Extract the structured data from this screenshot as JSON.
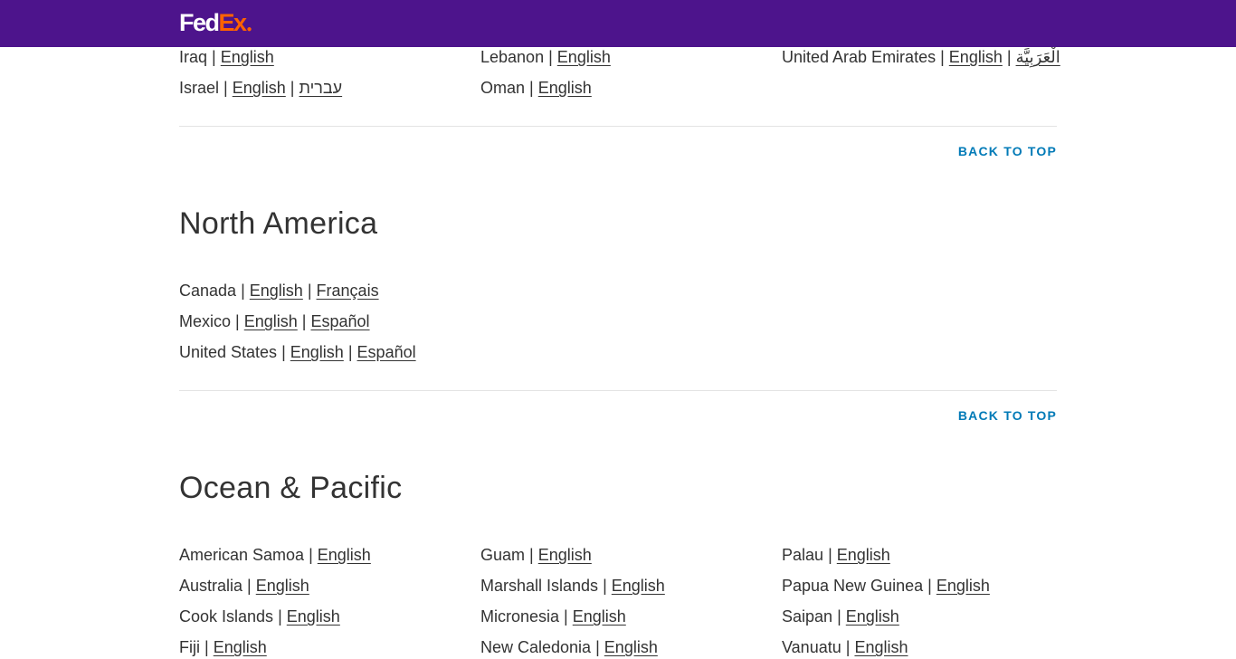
{
  "header": {
    "logo_fed": "Fed",
    "logo_ex": "Ex"
  },
  "common": {
    "separator": "|",
    "back_to_top": "BACK TO TOP"
  },
  "middle_east": {
    "rows": [
      {
        "country": "Iraq",
        "langs": [
          "English"
        ]
      },
      {
        "country": "Israel",
        "langs": [
          "English",
          "עברית"
        ]
      },
      {
        "country": "Lebanon",
        "langs": [
          "English"
        ]
      },
      {
        "country": "Oman",
        "langs": [
          "English"
        ]
      },
      {
        "country": "United Arab Emirates",
        "langs": [
          "English",
          "الْعَرَبِيَّة"
        ]
      }
    ]
  },
  "north_america": {
    "title": "North America",
    "rows": [
      {
        "country": "Canada",
        "langs": [
          "English",
          "Français"
        ]
      },
      {
        "country": "Mexico",
        "langs": [
          "English",
          "Español"
        ]
      },
      {
        "country": "United States",
        "langs": [
          "English",
          "Español"
        ]
      }
    ]
  },
  "ocean_pacific": {
    "title": "Ocean & Pacific",
    "rows": [
      {
        "country": "American Samoa",
        "langs": [
          "English"
        ]
      },
      {
        "country": "Australia",
        "langs": [
          "English"
        ]
      },
      {
        "country": "Cook Islands",
        "langs": [
          "English"
        ]
      },
      {
        "country": "Fiji",
        "langs": [
          "English"
        ]
      },
      {
        "country": "Guam",
        "langs": [
          "English"
        ]
      },
      {
        "country": "Marshall Islands",
        "langs": [
          "English"
        ]
      },
      {
        "country": "Micronesia",
        "langs": [
          "English"
        ]
      },
      {
        "country": "New Caledonia",
        "langs": [
          "English"
        ]
      },
      {
        "country": "Palau",
        "langs": [
          "English"
        ]
      },
      {
        "country": "Papua New Guinea",
        "langs": [
          "English"
        ]
      },
      {
        "country": "Saipan",
        "langs": [
          "English"
        ]
      },
      {
        "country": "Vanuatu",
        "langs": [
          "English"
        ]
      }
    ]
  }
}
